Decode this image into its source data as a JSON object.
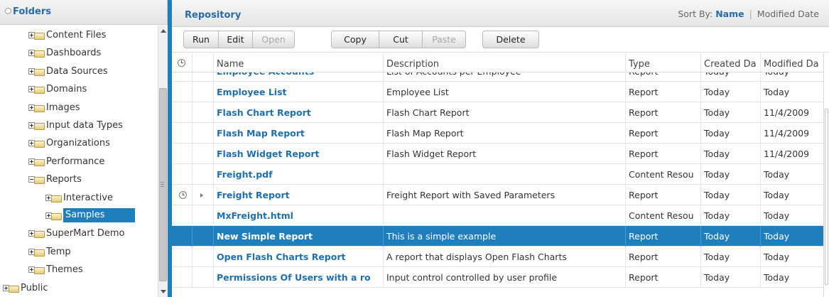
{
  "folders": {
    "title": "Folders",
    "items": [
      {
        "label": "Content Files",
        "expanded": false,
        "level": 1
      },
      {
        "label": "Dashboards",
        "expanded": false,
        "level": 1
      },
      {
        "label": "Data Sources",
        "expanded": false,
        "level": 1
      },
      {
        "label": "Domains",
        "expanded": false,
        "level": 1
      },
      {
        "label": "Images",
        "expanded": false,
        "level": 1
      },
      {
        "label": "Input data Types",
        "expanded": false,
        "level": 1
      },
      {
        "label": "Organizations",
        "expanded": false,
        "level": 1
      },
      {
        "label": "Performance",
        "expanded": false,
        "level": 1
      },
      {
        "label": "Reports",
        "expanded": true,
        "level": 1
      },
      {
        "label": "Interactive",
        "expanded": false,
        "level": 2
      },
      {
        "label": "Samples",
        "expanded": false,
        "level": 2,
        "selected": true
      },
      {
        "label": "SuperMart Demo",
        "expanded": false,
        "level": 1
      },
      {
        "label": "Temp",
        "expanded": false,
        "level": 1
      },
      {
        "label": "Themes",
        "expanded": false,
        "level": 1
      },
      {
        "label": "Public",
        "expanded": false,
        "level": 0
      }
    ]
  },
  "repository": {
    "title": "Repository",
    "sort": {
      "prefix": "Sort By:",
      "name": "Name",
      "sep": "|",
      "modified": "Modified Date"
    }
  },
  "toolbar": {
    "run": "Run",
    "edit": "Edit",
    "open": "Open",
    "copy": "Copy",
    "cut": "Cut",
    "paste": "Paste",
    "delete": "Delete"
  },
  "grid": {
    "headers": {
      "name": "Name",
      "description": "Description",
      "type": "Type",
      "created": "Created Da",
      "modified": "Modified Da"
    },
    "rows": [
      {
        "name": "Employee Accounts",
        "description": "List of Accounts per Employee",
        "type": "Report",
        "created": "Today",
        "modified": "Today"
      },
      {
        "name": "Employee List",
        "description": "Employee List",
        "type": "Report",
        "created": "Today",
        "modified": "Today"
      },
      {
        "name": "Flash Chart Report",
        "description": "Flash Chart Report",
        "type": "Report",
        "created": "Today",
        "modified": "11/4/2009"
      },
      {
        "name": "Flash Map Report",
        "description": "Flash Map Report",
        "type": "Report",
        "created": "Today",
        "modified": "11/4/2009"
      },
      {
        "name": "Flash Widget Report",
        "description": "Flash Widget Report",
        "type": "Report",
        "created": "Today",
        "modified": "11/4/2009"
      },
      {
        "name": "Freight.pdf",
        "description": "",
        "type": "Content Resou",
        "created": "Today",
        "modified": "Today"
      },
      {
        "name": "Freight Report",
        "description": "Freight Report with Saved Parameters",
        "type": "Report",
        "created": "Today",
        "modified": "Today",
        "scheduled": true
      },
      {
        "name": "MxFreight.html",
        "description": "",
        "type": "Content Resou",
        "created": "Today",
        "modified": "Today"
      },
      {
        "name": "New Simple Report",
        "description": "This is a simple example",
        "type": "Report",
        "created": "Today",
        "modified": "Today",
        "selected": true
      },
      {
        "name": "Open Flash Charts Report",
        "description": "A report that displays Open Flash Charts",
        "type": "Report",
        "created": "Today",
        "modified": "Today"
      },
      {
        "name": "Permissions Of Users with a ro",
        "description": "Input control controlled by user profile",
        "type": "Report",
        "created": "Today",
        "modified": "Today"
      }
    ]
  },
  "colors": {
    "accent": "#1f7fbd",
    "link": "#1f6fae"
  }
}
